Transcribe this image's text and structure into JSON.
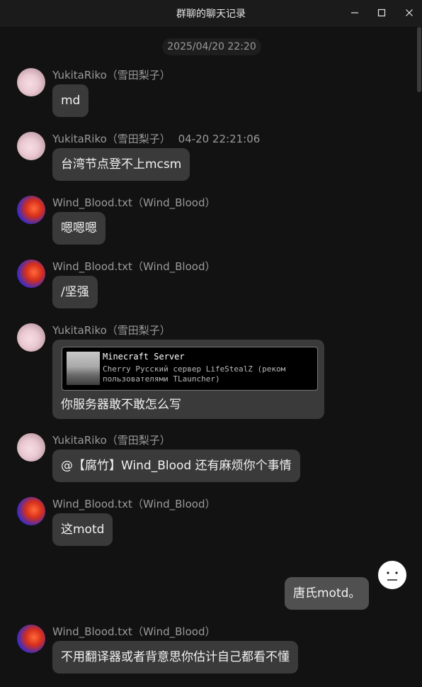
{
  "window": {
    "title": "群聊的聊天记录",
    "minimize_icon": "minimize-icon",
    "maximize_icon": "maximize-icon",
    "close_icon": "close-icon"
  },
  "timestamp": "2025/04/20 22:20",
  "messages": [
    {
      "sender": "YukitaRiko（雪田梨子）",
      "text": "md"
    },
    {
      "sender": "YukitaRiko（雪田梨子）",
      "time": "04-20 22:21:06",
      "text": "台湾节点登不上mcsm"
    },
    {
      "sender": "Wind_Blood.txt（Wind_Blood）",
      "text": "嗯嗯嗯"
    },
    {
      "sender": "Wind_Blood.txt（Wind_Blood）",
      "text": "/坚强"
    },
    {
      "sender": "YukitaRiko（雪田梨子）",
      "card": {
        "title": "Minecraft Server",
        "desc": "Cherry Русский сервер LifeStealZ (реком пользователями TLauncher)"
      },
      "text": "你服务器敢不敢怎么写"
    },
    {
      "sender": "YukitaRiko（雪田梨子）",
      "text": "@【腐竹】Wind_Blood 还有麻烦你个事情"
    },
    {
      "sender": "Wind_Blood.txt（Wind_Blood）",
      "text": "这motd"
    },
    {
      "self": true,
      "text": "唐氏motd。"
    },
    {
      "sender": "Wind_Blood.txt（Wind_Blood）",
      "text": "不用翻译器或者背意思你估计自己都看不懂"
    }
  ]
}
